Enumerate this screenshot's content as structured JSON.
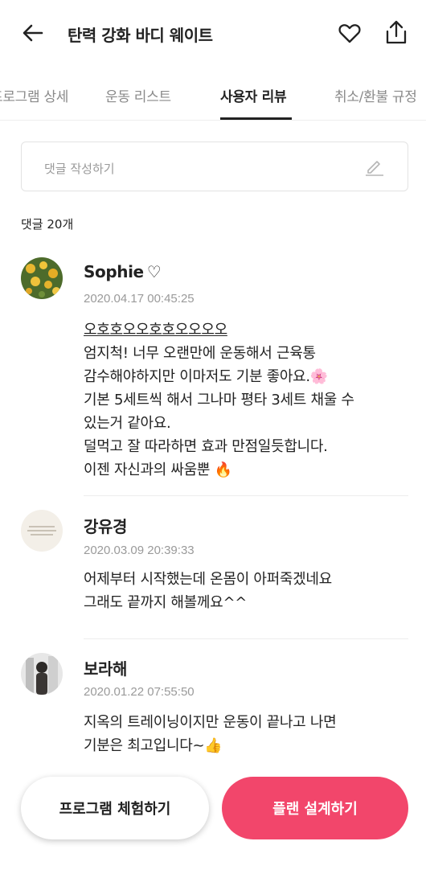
{
  "header": {
    "title": "탄력 강화 바디 웨이트",
    "back_icon": "back-arrow-icon",
    "heart_icon": "heart-outline-icon",
    "share_icon": "share-icon"
  },
  "tabs": [
    {
      "label": "프로그램 상세",
      "active": false
    },
    {
      "label": "운동 리스트",
      "active": false
    },
    {
      "label": "사용자 리뷰",
      "active": true
    },
    {
      "label": "취소/환불 규정",
      "active": false
    }
  ],
  "comment_input": {
    "placeholder": "댓글 작성하기",
    "icon": "pencil-icon"
  },
  "comment_count": "댓글 20개",
  "reviews": [
    {
      "name": "Sophie",
      "name_suffix": "♡",
      "date": "2020.04.17 00:45:25",
      "lines": [
        "오호호오오호호오오오오",
        "엄지척! 너무 오랜만에 운동해서 근육통",
        "감수해야하지만 이마저도 기분 좋아요.🌸",
        "기본 5세트씩 해서 그나마 평타 3세트 채울 수",
        "있는거 같아요.",
        "덜먹고 잘 따라하면 효과 만점일듯합니다.",
        "이젠 자신과의 싸움뿐 🔥"
      ]
    },
    {
      "name": "강유경",
      "date": "2020.03.09 20:39:33",
      "lines": [
        "어제부터 시작했는데 온몸이 아퍼죽겠네요",
        "그래도 끝까지 해볼께요^^"
      ]
    },
    {
      "name": "보라해",
      "date": "2020.01.22 07:55:50",
      "lines": [
        "지옥의 트레이닝이지만 운동이 끝나고 나면",
        "기분은 최고입니다~👍"
      ]
    }
  ],
  "buttons": {
    "trial": "프로그램 체험하기",
    "plan": "플랜 설계하기"
  },
  "colors": {
    "accent": "#f2466b",
    "text": "#222222",
    "muted": "#9a9a9a"
  }
}
